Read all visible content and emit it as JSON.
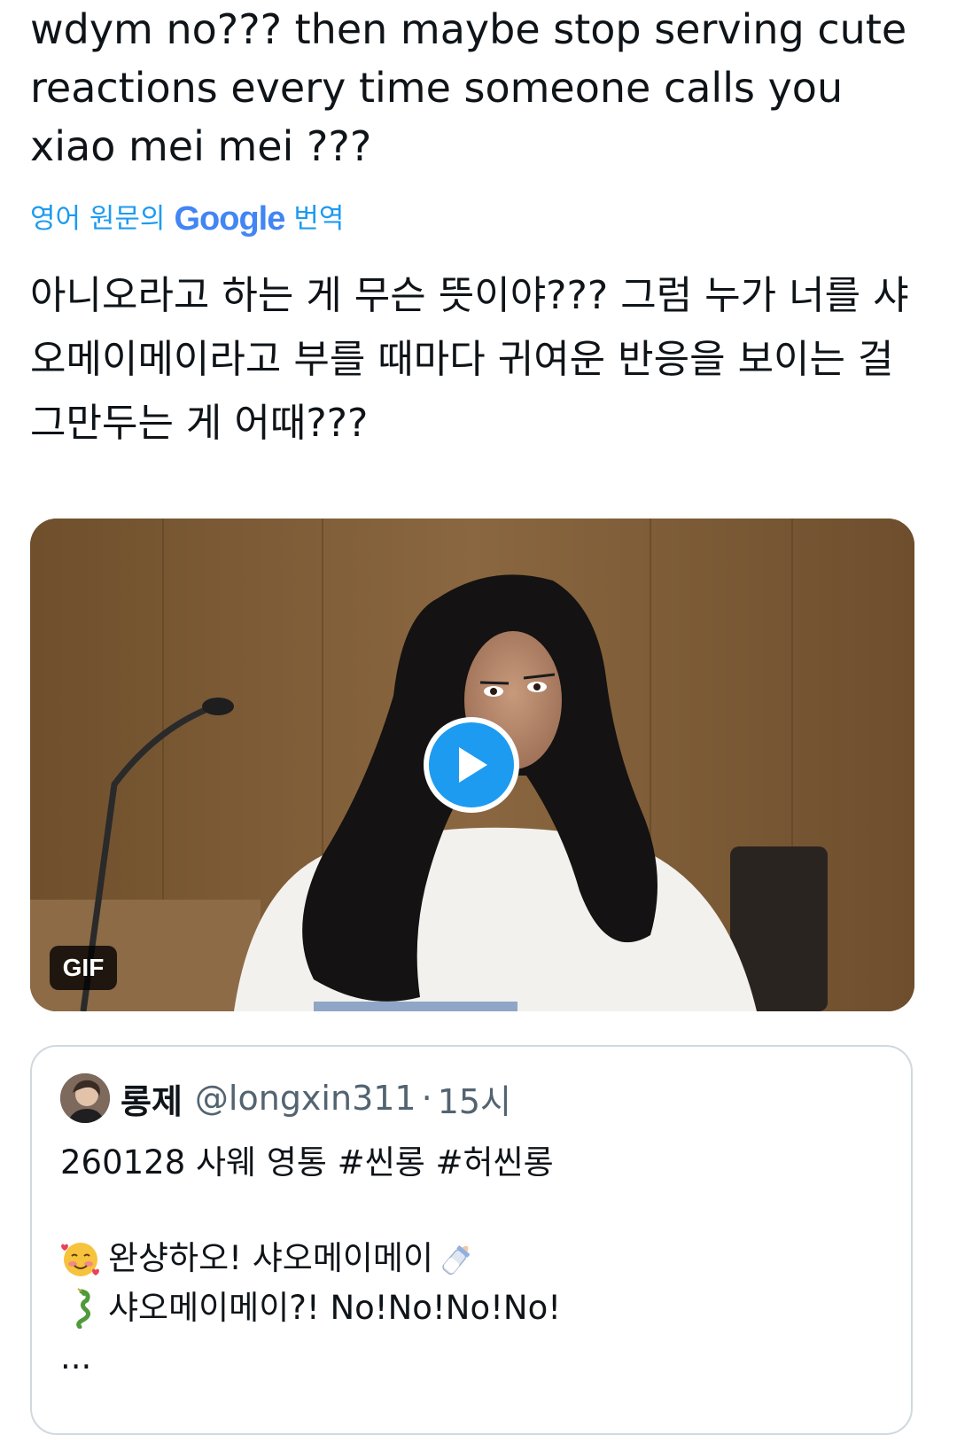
{
  "tweet": {
    "text": "wdym no??? then maybe stop serving cute reactions every time someone calls you xiao mei mei ???",
    "translate": {
      "prefix": "영어 원문의",
      "brand": "Google",
      "suffix": "번역"
    },
    "translation": "아니오라고 하는 게 무슨 뜻이야??? 그럼 누가 너를 샤오메이메이라고 부를 때마다 귀여운 반응을 보이는 걸 그만두는 게 어때???"
  },
  "media": {
    "badge": "GIF",
    "play_icon": "play-icon"
  },
  "quote": {
    "name": "롱제",
    "handle": "@longxin311",
    "dot": "·",
    "time": "15시",
    "line1": "260128 사웨 영통 #씬롱 #허씬롱",
    "line2_text": "완샹하오! 샤오메이메이",
    "line2_icons": [
      "smiling-face-with-hearts-icon",
      "baby-bottle-icon"
    ],
    "line3_text": "샤오메이메이?! No!No!No!No!",
    "line3_icon": "dragon-icon",
    "line4": "..."
  },
  "colors": {
    "link_blue": "#1d9bf0",
    "text": "#0f1419",
    "muted": "#536471",
    "border": "#cfd9de"
  }
}
